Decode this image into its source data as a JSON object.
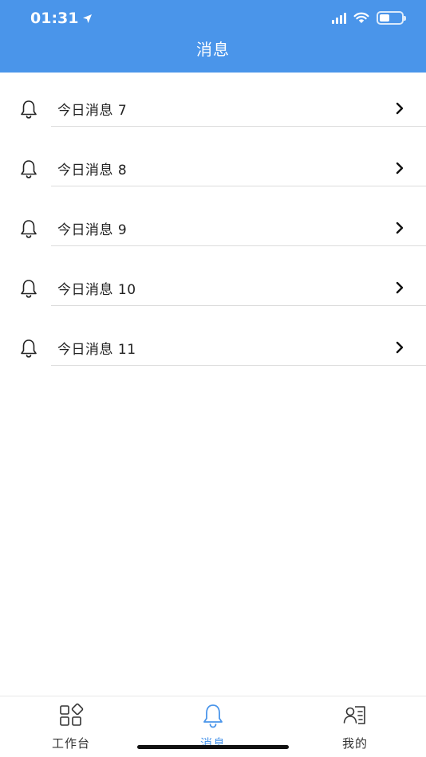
{
  "status_bar": {
    "time": "01:31"
  },
  "header": {
    "title": "消息"
  },
  "messages": [
    {
      "label": "今日消息 7"
    },
    {
      "label": "今日消息 8"
    },
    {
      "label": "今日消息 9"
    },
    {
      "label": "今日消息 10"
    },
    {
      "label": "今日消息 11"
    }
  ],
  "tabbar": {
    "tabs": [
      {
        "label": "工作台",
        "icon": "workbench-icon"
      },
      {
        "label": "消息",
        "icon": "bell-icon",
        "active": true
      },
      {
        "label": "我的",
        "icon": "profile-card-icon"
      }
    ]
  },
  "colors": {
    "accent": "#4a95ea",
    "separator": "#dcdcdc",
    "text": "#222222"
  }
}
